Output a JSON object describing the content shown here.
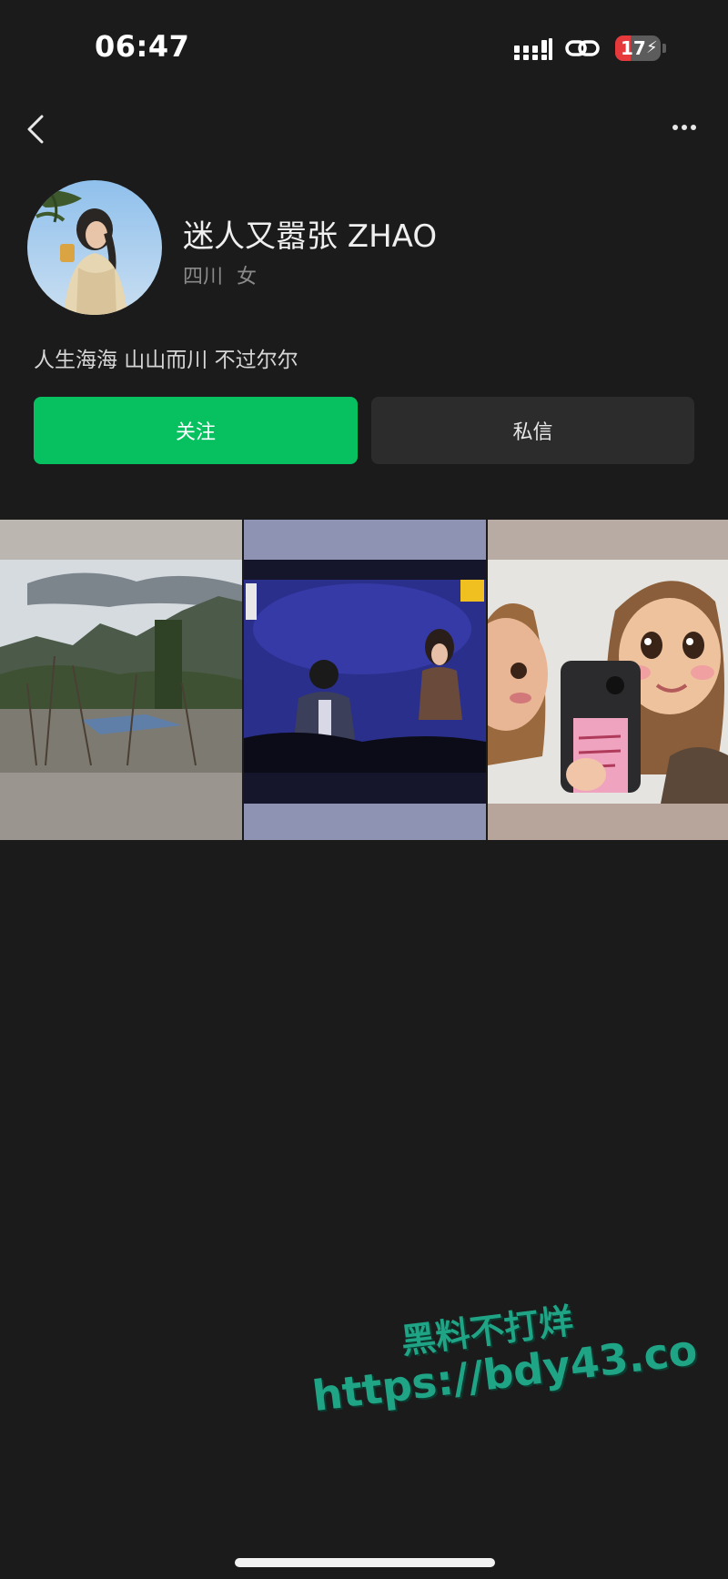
{
  "status_bar": {
    "time": "06:47",
    "battery_level": "17",
    "icons": [
      "signal-icon",
      "link-icon",
      "battery-charging-icon"
    ]
  },
  "nav": {
    "back_icon": "chevron-left-icon",
    "more_icon": "more-icon"
  },
  "profile": {
    "name": "迷人又嚣张 ZHAO",
    "location": "四川",
    "gender": "女",
    "bio": "人生海海 山山而川 不过尔尔"
  },
  "actions": {
    "follow_label": "关注",
    "message_label": "私信"
  },
  "photos": [
    {
      "name": "mountain-landscape-photo"
    },
    {
      "name": "stage-performance-photo"
    },
    {
      "name": "cartoon-selfie-photo"
    }
  ],
  "watermark": {
    "line1": "黑料不打烊",
    "line2": "https://bdy43.co"
  },
  "colors": {
    "background": "#1b1b1b",
    "follow_button": "#07c160",
    "message_button": "#2c2c2c",
    "watermark": "#1fa486"
  }
}
